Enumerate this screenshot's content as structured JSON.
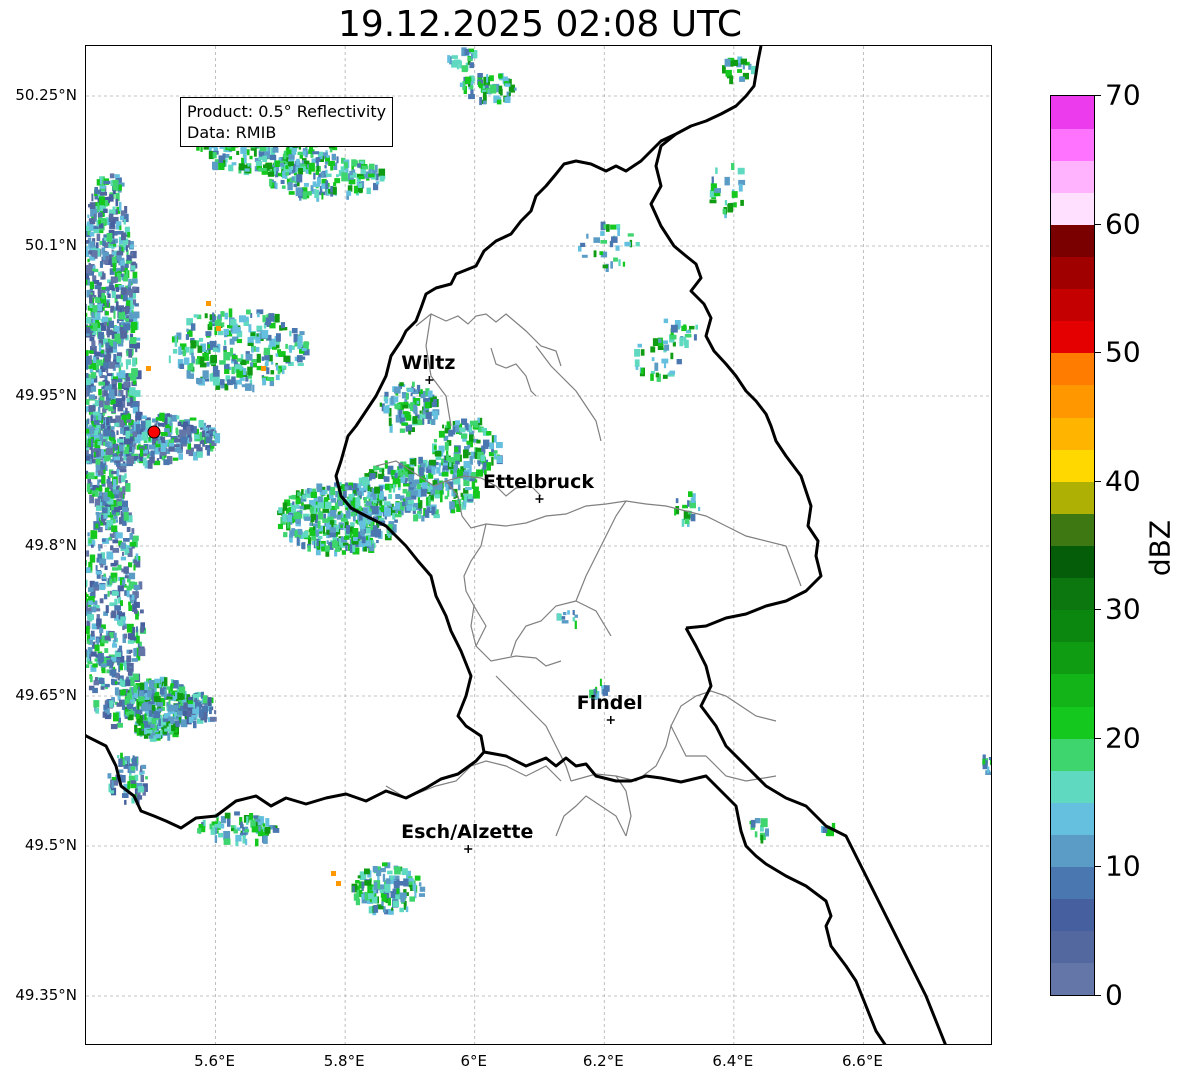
{
  "title": "19.12.2025 02:08 UTC",
  "info_box": {
    "product": "Product: 0.5° Reflectivity",
    "data": "Data: RMIB"
  },
  "latitude_labels": [
    "50.25°N",
    "50.1°N",
    "49.95°N",
    "49.8°N",
    "49.65°N",
    "49.5°N",
    "49.35°N"
  ],
  "longitude_labels": [
    "5.6°E",
    "5.8°E",
    "6°E",
    "6.2°E",
    "6.4°E",
    "6.6°E"
  ],
  "cities": [
    {
      "name": "Wiltz",
      "lon": 5.93,
      "lat": 49.966
    },
    {
      "name": "Ettelbruck",
      "lon": 6.1,
      "lat": 49.847
    },
    {
      "name": "Findel",
      "lon": 6.21,
      "lat": 49.626
    },
    {
      "name": "Esch/Alzette",
      "lon": 5.99,
      "lat": 49.497
    }
  ],
  "radar_site": {
    "lon": 5.505,
    "lat": 49.914,
    "color": "#ff0000"
  },
  "colorbar": {
    "unit": "dBZ",
    "min": 0,
    "max": 70,
    "tick_labels": [
      "0",
      "10",
      "20",
      "30",
      "40",
      "50",
      "60",
      "70"
    ],
    "colors": [
      "#6476a8",
      "#5468a0",
      "#455f9f",
      "#4a77b0",
      "#5a9cc6",
      "#64c0de",
      "#5fd9c0",
      "#3ed56e",
      "#14c81e",
      "#12b418",
      "#0f9c12",
      "#0b8710",
      "#0b770e",
      "#065d09",
      "#3e7812",
      "#aeb003",
      "#ffd800",
      "#ffb400",
      "#ff9800",
      "#ff7c00",
      "#e40000",
      "#c40000",
      "#a10000",
      "#7a0000",
      "#ffe0ff",
      "#ffb3ff",
      "#ff73ff",
      "#ec3bec"
    ]
  },
  "map": {
    "lon_range": [
      5.4,
      6.8
    ],
    "lat_range": [
      49.3,
      50.3
    ],
    "border_color": "#000000",
    "canton_color": "#808080",
    "grid": true
  }
}
